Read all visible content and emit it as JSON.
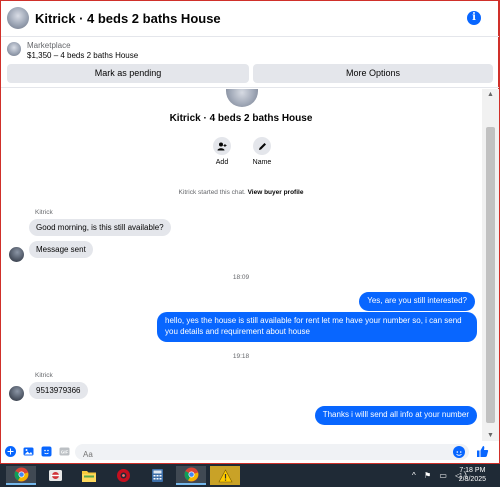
{
  "header": {
    "title": "Kitrick · 4 beds 2 baths House",
    "info_icon": "info-icon"
  },
  "listing": {
    "section": "Marketplace",
    "price_title": "$1,350 – 4 beds 2 baths House",
    "mark_pending": "Mark as pending",
    "more_options": "More Options"
  },
  "profile": {
    "name": "Kitrick · 4 beds 2 baths House",
    "add_label": "Add",
    "name_label": "Name"
  },
  "system": {
    "started_prefix": "Kitrick started this chat.",
    "view_profile": "View buyer profile"
  },
  "messages": {
    "sender": "Kitrick",
    "m1": "Good morning, is this still available?",
    "m2": "Message sent",
    "time1": "18:09",
    "m3": "Yes, are you still interested?",
    "m4_line1": "hello, yes the house is still available for rent  let me have your number so, i can send",
    "m4_line2": "you details and requirement about house",
    "time2": "19:18",
    "sender2": "Kitrick",
    "m5": "9513979366",
    "m6": "Thanks i willl send all info at your number"
  },
  "composer": {
    "placeholder": "Aa"
  },
  "taskbar": {
    "time": "7:18 PM",
    "date": "2/3/2025"
  },
  "colors": {
    "accent": "#0866ff",
    "bubble_in": "#e4e6eb",
    "taskbar": "#1f2a36"
  }
}
